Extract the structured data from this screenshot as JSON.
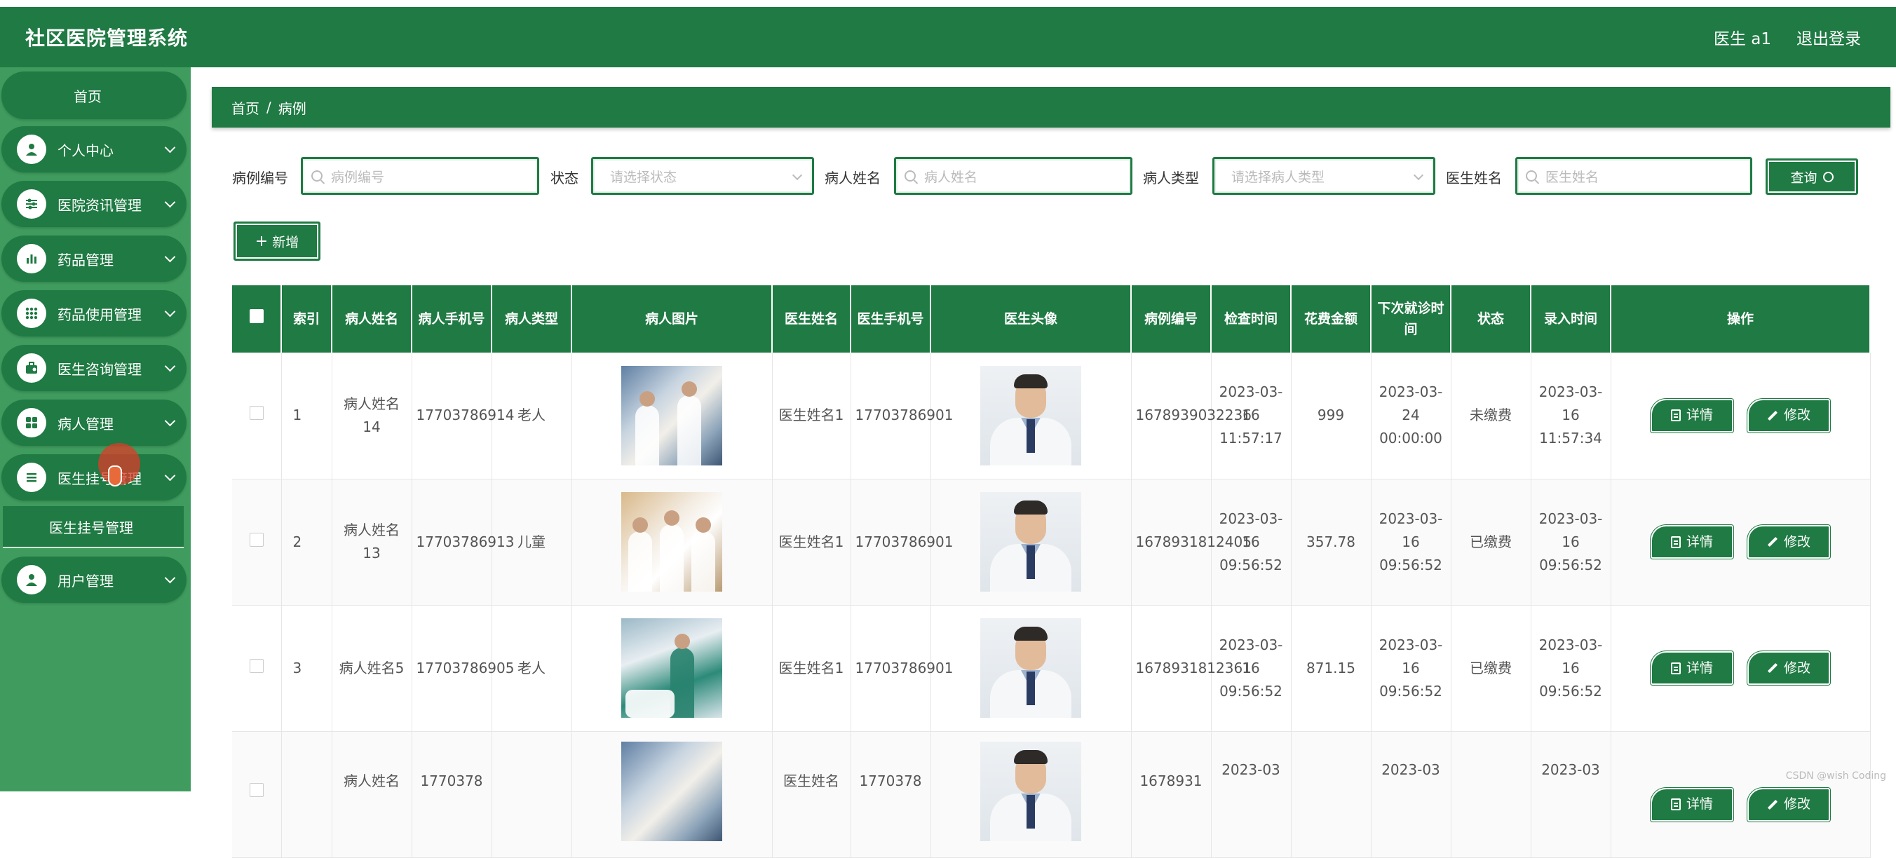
{
  "header": {
    "title": "社区医院管理系统",
    "user": "医生 a1",
    "logout": "退出登录"
  },
  "sidebar": {
    "home": "首页",
    "items": [
      {
        "label": "个人中心",
        "icon": "user-icon"
      },
      {
        "label": "医院资讯管理",
        "icon": "sliders-icon"
      },
      {
        "label": "药品管理",
        "icon": "bar-chart-icon"
      },
      {
        "label": "药品使用管理",
        "icon": "grid-dots-icon"
      },
      {
        "label": "医生咨询管理",
        "icon": "briefcase-icon"
      },
      {
        "label": "病人管理",
        "icon": "apps-icon"
      },
      {
        "label": "医生挂号管理",
        "icon": "list-icon"
      },
      {
        "label": "用户管理",
        "icon": "user-icon"
      }
    ],
    "sub_item": "医生挂号管理"
  },
  "breadcrumb": {
    "home": "首页",
    "sep": "/",
    "current": "病例"
  },
  "search": {
    "case_no_label": "病例编号",
    "case_no_placeholder": "病例编号",
    "status_label": "状态",
    "status_placeholder": "请选择状态",
    "patient_name_label": "病人姓名",
    "patient_name_placeholder": "病人姓名",
    "patient_type_label": "病人类型",
    "patient_type_placeholder": "请选择病人类型",
    "doctor_name_label": "医生姓名",
    "doctor_name_placeholder": "医生姓名",
    "query_button": "查询",
    "add_button": "新增"
  },
  "table": {
    "headers": [
      "索引",
      "病人姓名",
      "病人手机号",
      "病人类型",
      "病人图片",
      "医生姓名",
      "医生手机号",
      "医生头像",
      "病例编号",
      "检查时间",
      "花费金额",
      "下次就诊时间",
      "状态",
      "录入时间",
      "操作"
    ],
    "rows": [
      {
        "index": "1",
        "patient_name": "病人姓名14",
        "patient_phone": "17703786914",
        "patient_type": "老人",
        "doctor_name": "医生姓名1",
        "doctor_phone": "17703786901",
        "case_no": "1678939032236",
        "check_time": "2023-03-16 11:57:17",
        "cost": "999",
        "next_visit": "2023-03-24 00:00:00",
        "status": "未缴费",
        "entry_time": "2023-03-16 11:57:34"
      },
      {
        "index": "2",
        "patient_name": "病人姓名13",
        "patient_phone": "17703786913",
        "patient_type": "儿童",
        "doctor_name": "医生姓名1",
        "doctor_phone": "17703786901",
        "case_no": "1678931812405",
        "check_time": "2023-03-16 09:56:52",
        "cost": "357.78",
        "next_visit": "2023-03-16 09:56:52",
        "status": "已缴费",
        "entry_time": "2023-03-16 09:56:52"
      },
      {
        "index": "3",
        "patient_name": "病人姓名5",
        "patient_phone": "17703786905",
        "patient_type": "老人",
        "doctor_name": "医生姓名1",
        "doctor_phone": "17703786901",
        "case_no": "1678931812361",
        "check_time": "2023-03-16 09:56:52",
        "cost": "871.15",
        "next_visit": "2023-03-16 09:56:52",
        "status": "已缴费",
        "entry_time": "2023-03-16 09:56:52"
      },
      {
        "index": "",
        "patient_name": "病人姓名",
        "patient_phone": "1770378",
        "patient_type": "",
        "doctor_name": "医生姓名",
        "doctor_phone": "1770378",
        "case_no": "1678931",
        "check_time": "2023-03",
        "cost": "",
        "next_visit": "2023-03",
        "status": "",
        "entry_time": "2023-03"
      }
    ],
    "detail_button": "详情",
    "edit_button": "修改"
  },
  "watermark": "CSDN @wish Coding",
  "colors": {
    "primary": "#1f7a43",
    "sidebar_bg": "#3f9c5e"
  }
}
